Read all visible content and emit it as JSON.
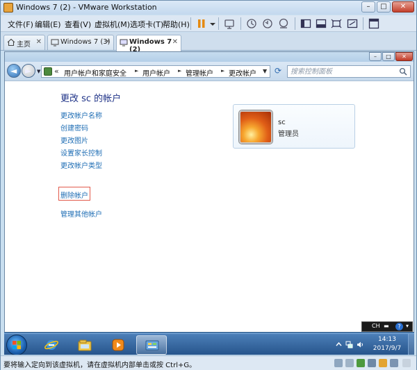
{
  "vmware": {
    "title": "Windows 7 (2) - VMware Workstation",
    "menu": [
      "文件(F)",
      "编辑(E)",
      "查看(V)",
      "虚拟机(M)",
      "选项卡(T)",
      "帮助(H)"
    ],
    "tabs": [
      {
        "label": "主页",
        "active": false
      },
      {
        "label": "Windows 7 (3)",
        "active": false
      },
      {
        "label": "Windows 7 (2)",
        "active": true
      }
    ],
    "status_text": "要将输入定向到该虚拟机，请在虚拟机内部单击或按 Ctrl+G。"
  },
  "explorer": {
    "breadcrumb": [
      "用户帐户和家庭安全",
      "用户帐户",
      "管理帐户",
      "更改帐户"
    ],
    "breadcrumb_prefix": "«",
    "search_placeholder": "搜索控制面板",
    "heading": "更改 sc 的帐户",
    "tasks": [
      "更改帐户名称",
      "创建密码",
      "更改图片",
      "设置家长控制",
      "更改帐户类型",
      "删除帐户"
    ],
    "other_link": "管理其他帐户",
    "account": {
      "name": "sc",
      "role": "管理员"
    }
  },
  "langbar": {
    "lang": "CH"
  },
  "taskbar": {
    "time": "14:13",
    "date": "2017/9/7"
  },
  "colors": {
    "link": "#1e6db4",
    "heading": "#1e3287",
    "highlight_box": "#e25a4c",
    "taskbar": "#27558c"
  }
}
